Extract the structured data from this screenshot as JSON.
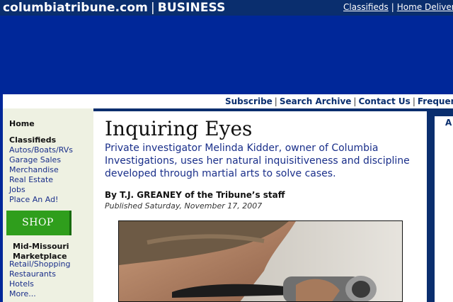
{
  "header": {
    "site": "columbiatribune.com",
    "separator": "|",
    "section": "BUSINESS",
    "links": [
      "Classifieds",
      "Home Delivery"
    ]
  },
  "utility": {
    "links": [
      "Subscribe",
      "Search Archive",
      "Contact Us",
      "Frequently"
    ]
  },
  "sidebar": {
    "home": "Home",
    "classifieds_heading": "Classifieds",
    "classifieds": [
      "Autos/Boats/RVs",
      "Garage Sales",
      "Merchandise",
      "Real Estate",
      "Jobs",
      "Place An Ad!"
    ],
    "shop_button": "SHOP",
    "marketplace_line1": "Mid-Missouri",
    "marketplace_line2": "Marketplace",
    "marketplace": [
      "Retail/Shopping",
      "Restaurants",
      "Hotels",
      "More..."
    ]
  },
  "article": {
    "headline": "Inquiring Eyes",
    "dek": "Private investigator Melinda Kidder, owner of Columbia Investigations, uses her natural inquisitiveness and discipline developed through martial arts to solve cases.",
    "byline": "By T.J. GREANEY of the Tribune’s staff",
    "published": "Published Saturday, November 17, 2007"
  },
  "rightcol": {
    "heading_initial": "A"
  },
  "colors": {
    "navy": "#0a2e6e",
    "banner_blue": "#002799",
    "shop_green": "#2f9e1c",
    "sidebar_bg": "#eef1e2",
    "link_blue": "#1a2f8a"
  }
}
